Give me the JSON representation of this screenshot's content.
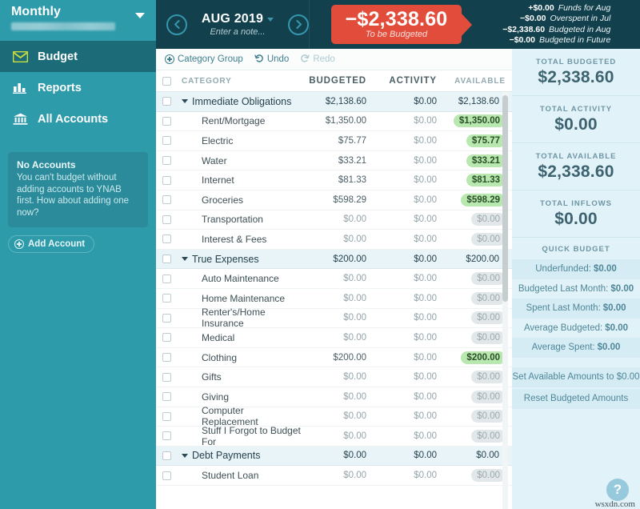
{
  "sidebar": {
    "budget_picker": {
      "title": "Monthly",
      "subtitle_redacted": true
    },
    "nav": [
      {
        "label": "Budget",
        "icon": "envelope-icon",
        "active": true
      },
      {
        "label": "Reports",
        "icon": "bar-chart-icon",
        "active": false
      },
      {
        "label": "All Accounts",
        "icon": "bank-icon",
        "active": false
      }
    ],
    "alert": {
      "title": "No Accounts",
      "body": "You can't budget without adding accounts to YNAB first. How about adding one now?"
    },
    "add_account_label": "Add Account"
  },
  "header": {
    "prev_icon": "chevron-left-icon",
    "next_icon": "chevron-right-icon",
    "month": "AUG 2019",
    "note_placeholder": "Enter a note...",
    "to_be_budgeted": {
      "amount": "−$2,338.60",
      "label": "To be Budgeted"
    },
    "breakdown": [
      {
        "amount": "+$0.00",
        "text": "Funds for Aug"
      },
      {
        "amount": "−$0.00",
        "text": "Overspent in Jul"
      },
      {
        "amount": "−$2,338.60",
        "text": "Budgeted in Aug"
      },
      {
        "amount": "−$0.00",
        "text": "Budgeted in Future"
      }
    ]
  },
  "toolbar": {
    "category_group": "Category Group",
    "undo": "Undo",
    "redo": "Redo"
  },
  "table": {
    "columns": [
      "CATEGORY",
      "BUDGETED",
      "ACTIVITY",
      "AVAILABLE"
    ],
    "rows": [
      {
        "type": "group",
        "name": "Immediate Obligations",
        "budgeted": "$2,138.60",
        "activity": "$0.00",
        "available": "$2,138.60"
      },
      {
        "type": "item",
        "name": "Rent/Mortgage",
        "budgeted": "$1,350.00",
        "activity": "$0.00",
        "available": "$1,350.00",
        "state": "pos"
      },
      {
        "type": "item",
        "name": "Electric",
        "budgeted": "$75.77",
        "activity": "$0.00",
        "available": "$75.77",
        "state": "pos"
      },
      {
        "type": "item",
        "name": "Water",
        "budgeted": "$33.21",
        "activity": "$0.00",
        "available": "$33.21",
        "state": "pos"
      },
      {
        "type": "item",
        "name": "Internet",
        "budgeted": "$81.33",
        "activity": "$0.00",
        "available": "$81.33",
        "state": "pos"
      },
      {
        "type": "item",
        "name": "Groceries",
        "budgeted": "$598.29",
        "activity": "$0.00",
        "available": "$598.29",
        "state": "pos"
      },
      {
        "type": "item",
        "name": "Transportation",
        "budgeted": "$0.00",
        "activity": "$0.00",
        "available": "$0.00",
        "state": "zero"
      },
      {
        "type": "item",
        "name": "Interest & Fees",
        "budgeted": "$0.00",
        "activity": "$0.00",
        "available": "$0.00",
        "state": "zero"
      },
      {
        "type": "group",
        "name": "True Expenses",
        "budgeted": "$200.00",
        "activity": "$0.00",
        "available": "$200.00"
      },
      {
        "type": "item",
        "name": "Auto Maintenance",
        "budgeted": "$0.00",
        "activity": "$0.00",
        "available": "$0.00",
        "state": "zero"
      },
      {
        "type": "item",
        "name": "Home Maintenance",
        "budgeted": "$0.00",
        "activity": "$0.00",
        "available": "$0.00",
        "state": "zero"
      },
      {
        "type": "item",
        "name": "Renter's/Home Insurance",
        "budgeted": "$0.00",
        "activity": "$0.00",
        "available": "$0.00",
        "state": "zero"
      },
      {
        "type": "item",
        "name": "Medical",
        "budgeted": "$0.00",
        "activity": "$0.00",
        "available": "$0.00",
        "state": "zero"
      },
      {
        "type": "item",
        "name": "Clothing",
        "budgeted": "$200.00",
        "activity": "$0.00",
        "available": "$200.00",
        "state": "pos"
      },
      {
        "type": "item",
        "name": "Gifts",
        "budgeted": "$0.00",
        "activity": "$0.00",
        "available": "$0.00",
        "state": "zero"
      },
      {
        "type": "item",
        "name": "Giving",
        "budgeted": "$0.00",
        "activity": "$0.00",
        "available": "$0.00",
        "state": "zero"
      },
      {
        "type": "item",
        "name": "Computer Replacement",
        "budgeted": "$0.00",
        "activity": "$0.00",
        "available": "$0.00",
        "state": "zero"
      },
      {
        "type": "item",
        "name": "Stuff I Forgot to Budget For",
        "budgeted": "$0.00",
        "activity": "$0.00",
        "available": "$0.00",
        "state": "zero"
      },
      {
        "type": "group",
        "name": "Debt Payments",
        "budgeted": "$0.00",
        "activity": "$0.00",
        "available": "$0.00"
      },
      {
        "type": "item",
        "name": "Student Loan",
        "budgeted": "$0.00",
        "activity": "$0.00",
        "available": "$0.00",
        "state": "zero"
      }
    ]
  },
  "side_panel": {
    "totals": [
      {
        "label": "TOTAL BUDGETED",
        "value": "$2,338.60"
      },
      {
        "label": "TOTAL ACTIVITY",
        "value": "$0.00"
      },
      {
        "label": "TOTAL AVAILABLE",
        "value": "$2,338.60"
      },
      {
        "label": "TOTAL INFLOWS",
        "value": "$0.00"
      }
    ],
    "quick_budget_header": "QUICK BUDGET",
    "quick_budget_items": [
      {
        "label": "Underfunded:",
        "value": "$0.00"
      },
      {
        "label": "Budgeted Last Month:",
        "value": "$0.00"
      },
      {
        "label": "Spent Last Month:",
        "value": "$0.00"
      },
      {
        "label": "Average Budgeted:",
        "value": "$0.00"
      },
      {
        "label": "Average Spent:",
        "value": "$0.00"
      }
    ],
    "actions": [
      "Set Available Amounts to $0.00",
      "Reset Budgeted Amounts"
    ]
  },
  "help": {
    "icon": "question-mark-icon",
    "label": "?"
  },
  "watermark": "wsxdn.com",
  "colors": {
    "sidebar_bg": "#2e9bab",
    "sidebar_active": "#1b6b79",
    "header_bg": "#12414d",
    "tbb_red": "#e24c3b",
    "panel_bg": "#e2f2f9",
    "pill_green": "#b8e8b0",
    "pill_gray": "#e2e8ea",
    "accent_teal": "#3497ae"
  }
}
